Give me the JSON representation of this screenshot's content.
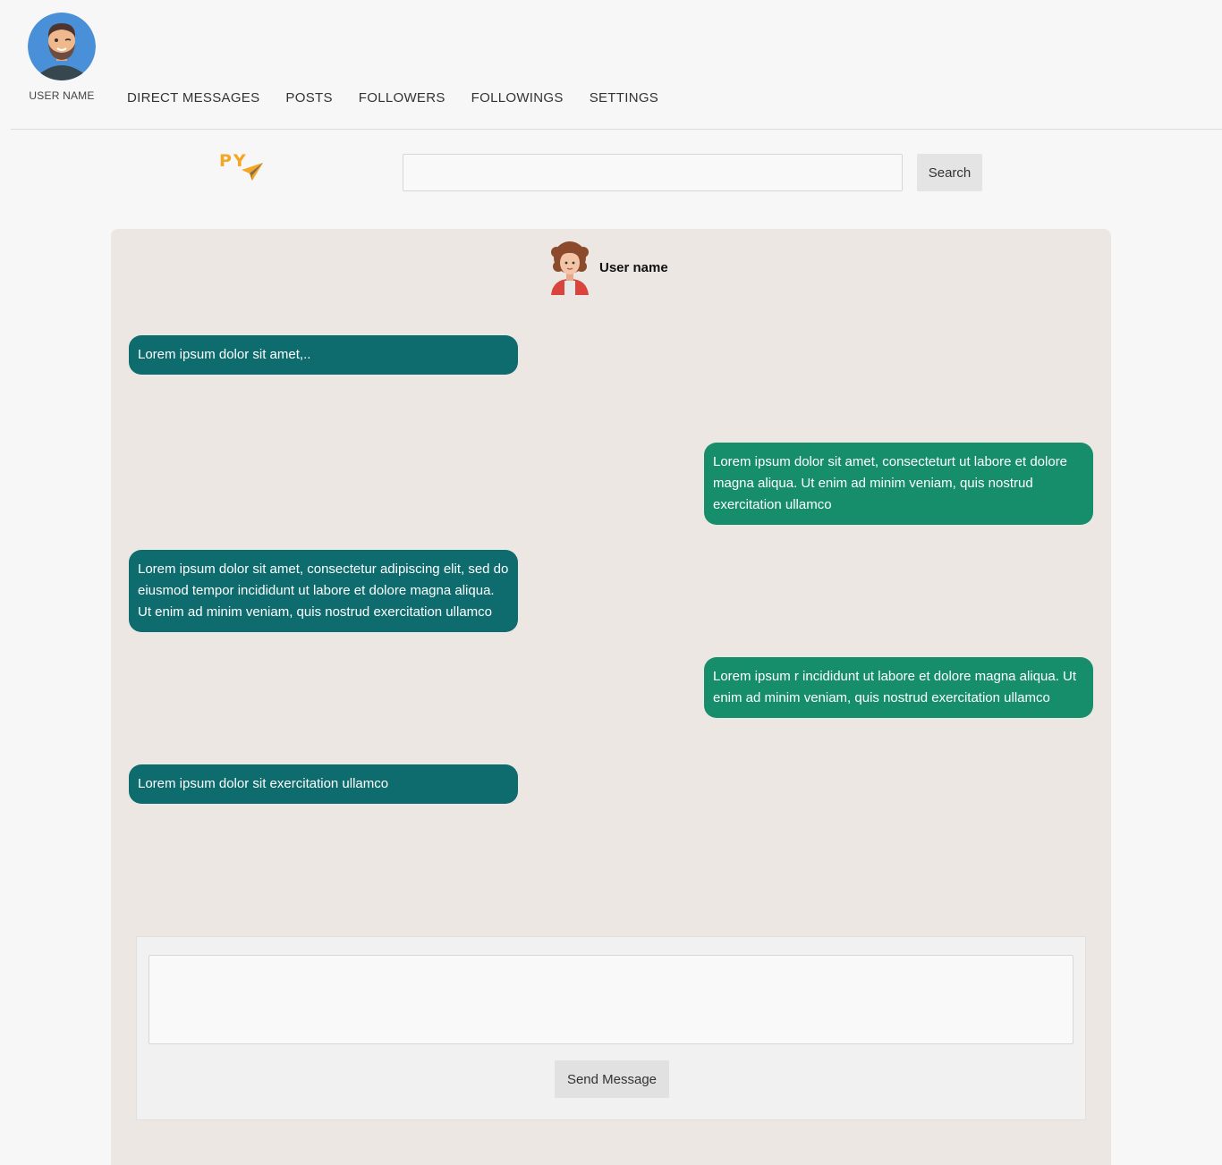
{
  "header": {
    "user_name": "USER NAME",
    "avatar_icon": "bearded-man-avatar-icon",
    "nav": [
      {
        "label": "DIRECT MESSAGES"
      },
      {
        "label": "POSTS"
      },
      {
        "label": "FOLLOWERS"
      },
      {
        "label": "FOLLOWINGS"
      },
      {
        "label": "SETTINGS"
      }
    ]
  },
  "logo": {
    "text": "PY",
    "icon": "paper-plane-icon",
    "color": "#f5a623"
  },
  "search": {
    "placeholder": "",
    "value": "",
    "button_label": "Search"
  },
  "chat": {
    "contact_name": "User name",
    "contact_avatar_icon": "curly-hair-avatar-icon",
    "messages": [
      {
        "direction": "in",
        "text": "Lorem ipsum dolor sit amet,.."
      },
      {
        "direction": "out",
        "text": "Lorem ipsum dolor sit amet, consecteturt ut labore et dolore magna aliqua. Ut enim ad minim veniam, quis nostrud exercitation ullamco"
      },
      {
        "direction": "in",
        "text": "Lorem ipsum dolor sit amet, consectetur adipiscing elit, sed do eiusmod tempor incididunt ut labore et dolore magna aliqua. Ut enim ad minim veniam, quis nostrud exercitation ullamco"
      },
      {
        "direction": "out",
        "text": "Lorem ipsum r incididunt ut labore et dolore magna aliqua. Ut enim ad minim veniam, quis nostrud exercitation ullamco"
      },
      {
        "direction": "in",
        "text": "Lorem ipsum dolor sit exercitation ullamco"
      }
    ],
    "incoming_color": "#0e6c6e",
    "outgoing_color": "#168e6b"
  },
  "composer": {
    "placeholder": "",
    "value": "",
    "send_label": "Send Message"
  }
}
